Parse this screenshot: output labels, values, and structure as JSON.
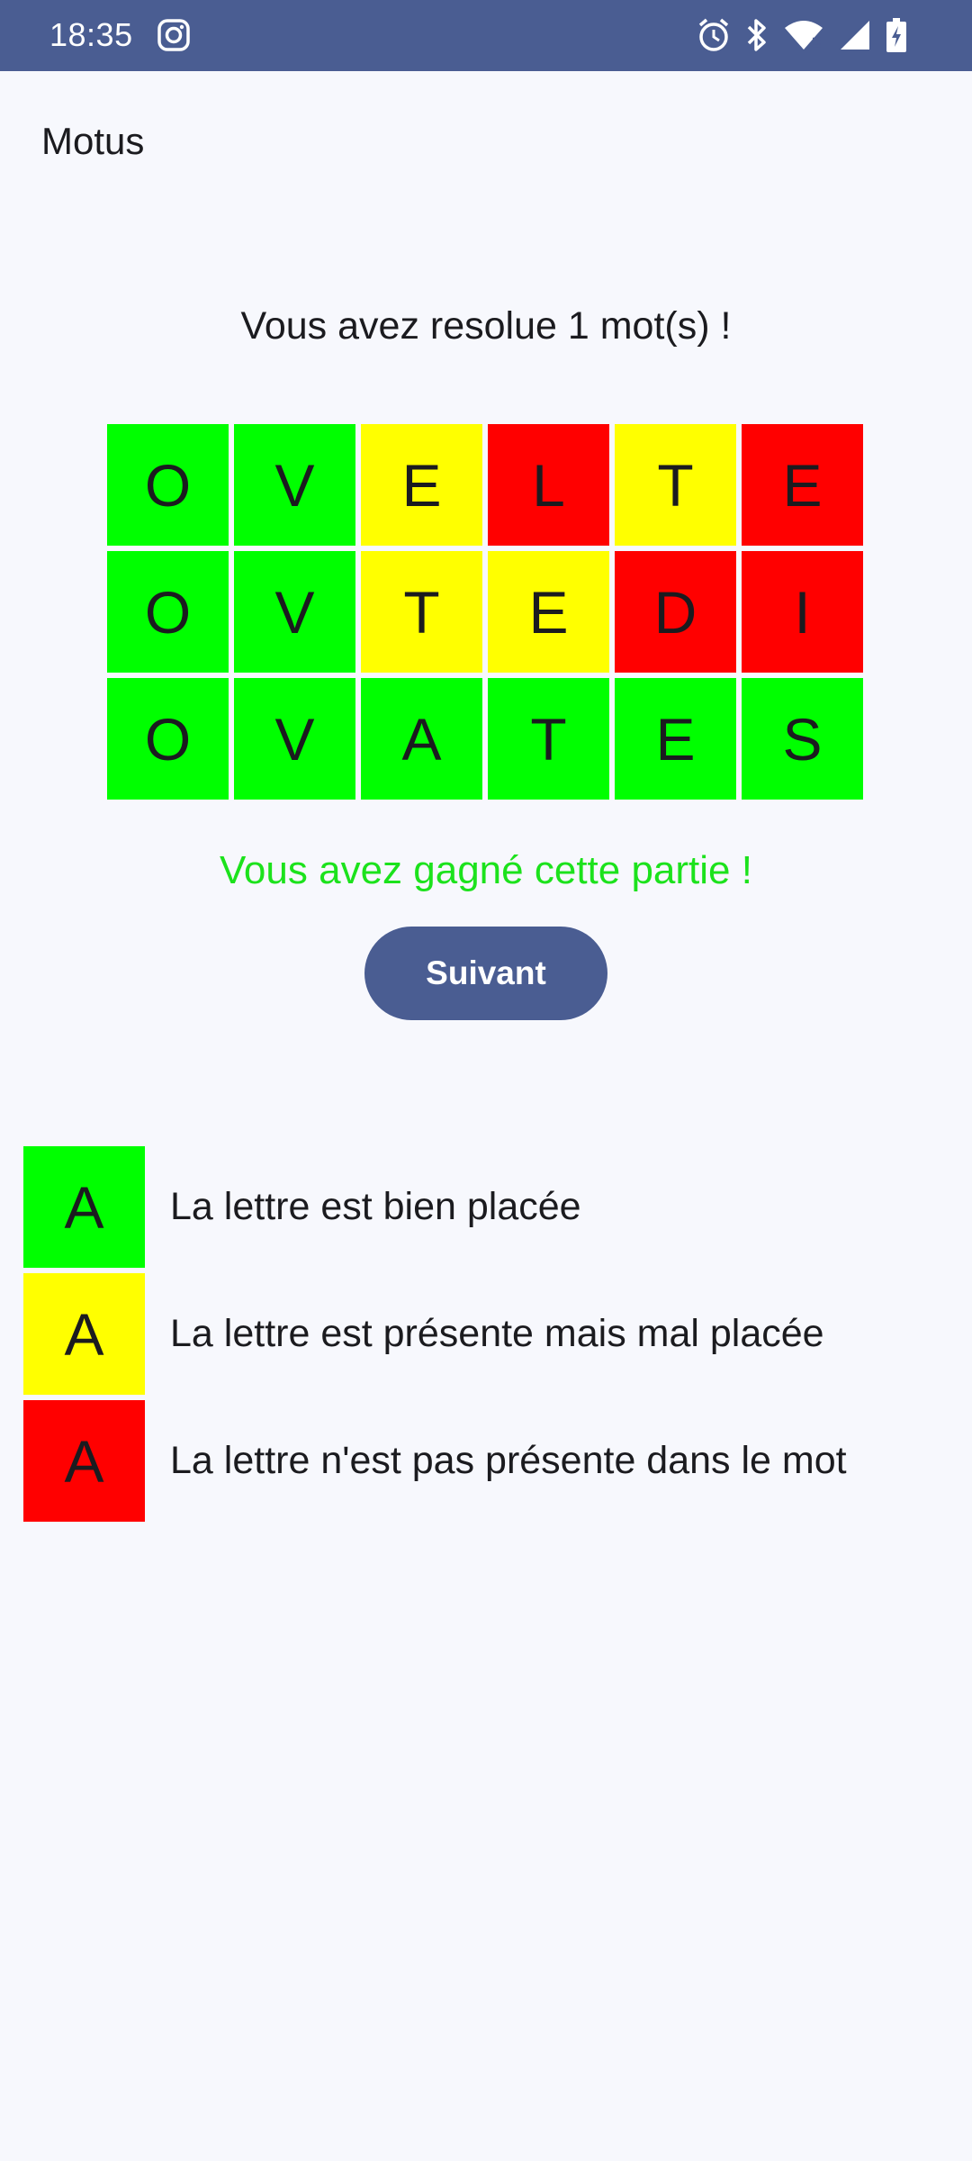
{
  "status_bar": {
    "time": "18:35",
    "icons": [
      "instagram-icon",
      "alarm-icon",
      "bluetooth-icon",
      "wifi-icon",
      "signal-icon",
      "battery-charging-icon"
    ]
  },
  "app": {
    "title": "Motus",
    "solved_message": "Vous avez resolue 1 mot(s) !",
    "win_message": "Vous avez gagné cette partie !",
    "next_button_label": "Suivant"
  },
  "colors": {
    "status_bar": "#4a5d92",
    "correct": "#00ff00",
    "misplaced": "#ffff00",
    "absent": "#ff0000",
    "win_text": "#1ce21c",
    "button": "#4a5d92",
    "background": "#f7f8fd"
  },
  "grid": {
    "rows": [
      [
        {
          "letter": "O",
          "state": "correct"
        },
        {
          "letter": "V",
          "state": "correct"
        },
        {
          "letter": "E",
          "state": "misplaced"
        },
        {
          "letter": "L",
          "state": "absent"
        },
        {
          "letter": "T",
          "state": "misplaced"
        },
        {
          "letter": "E",
          "state": "absent"
        }
      ],
      [
        {
          "letter": "O",
          "state": "correct"
        },
        {
          "letter": "V",
          "state": "correct"
        },
        {
          "letter": "T",
          "state": "misplaced"
        },
        {
          "letter": "E",
          "state": "misplaced"
        },
        {
          "letter": "D",
          "state": "absent"
        },
        {
          "letter": "I",
          "state": "absent"
        }
      ],
      [
        {
          "letter": "O",
          "state": "correct"
        },
        {
          "letter": "V",
          "state": "correct"
        },
        {
          "letter": "A",
          "state": "correct"
        },
        {
          "letter": "T",
          "state": "correct"
        },
        {
          "letter": "E",
          "state": "correct"
        },
        {
          "letter": "S",
          "state": "correct"
        }
      ]
    ]
  },
  "legend": [
    {
      "letter": "A",
      "state": "correct",
      "text": "La lettre est bien placée"
    },
    {
      "letter": "A",
      "state": "misplaced",
      "text": "La lettre est présente mais mal placée"
    },
    {
      "letter": "A",
      "state": "absent",
      "text": "La lettre n'est pas présente dans le mot"
    }
  ]
}
